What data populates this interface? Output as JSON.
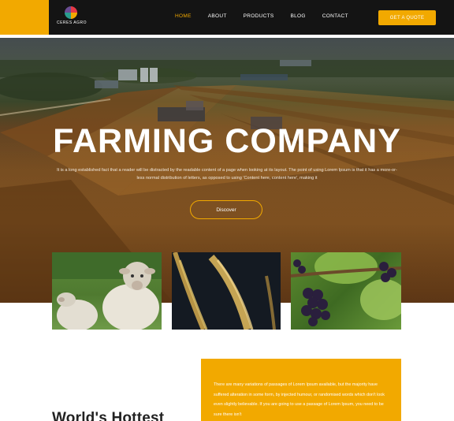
{
  "brand": {
    "name": "CERES AGRO",
    "accent": "#f2a900"
  },
  "nav": {
    "items": [
      {
        "label": "HOME",
        "active": true
      },
      {
        "label": "ABOUT",
        "active": false
      },
      {
        "label": "PRODUCTS",
        "active": false
      },
      {
        "label": "BLOG",
        "active": false
      },
      {
        "label": "CONTACT",
        "active": false
      }
    ],
    "cta": "GET A QUOTE"
  },
  "hero": {
    "title": "FARMING COMPANY",
    "body": "It is a long established fact that a reader will be distracted by the readable content of a page when looking at its layout. The point of using Lorem Ipsum is that it has a more-or-less normal distribution of letters, as opposed to using 'Content here, content here', making it",
    "button": "Discover"
  },
  "cards": [
    {
      "name": "sheep-photo"
    },
    {
      "name": "wheat-photo"
    },
    {
      "name": "grapes-photo"
    }
  ],
  "info": {
    "text": "There are many variations of passages of Lorem Ipsum available, but the majority have suffered alteration in some form, by injected humour, or randomised words which don't look even slightly believable. If you are going to use a passage of Lorem Ipsum, you need to be sure there isn't",
    "heading": "World's Hottest"
  }
}
